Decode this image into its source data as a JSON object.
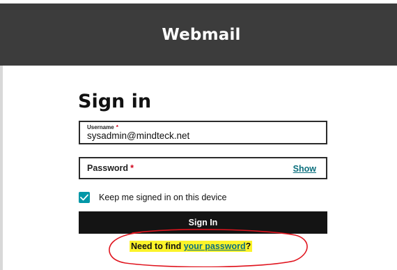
{
  "header": {
    "title": "Webmail"
  },
  "form": {
    "heading": "Sign in",
    "username": {
      "label": "Username",
      "required_marker": "*",
      "value": "sysadmin@mindteck.net"
    },
    "password": {
      "label": "Password",
      "required_marker": "*",
      "show_label": "Show"
    },
    "keep_signed_in": {
      "label": "Keep me signed in on this device",
      "checked": true
    },
    "submit_label": "Sign In",
    "help": {
      "prefix": "Need to find ",
      "link": "your password",
      "suffix": "?"
    }
  },
  "colors": {
    "header_bg": "#3c3c3c",
    "accent": "#0097a7",
    "link": "#0b6f7d",
    "button_bg": "#141414",
    "highlight": "#fbf329",
    "annotation": "#e0141e",
    "required": "#d0021b"
  },
  "icons": {
    "checkbox": "checkmark-icon"
  }
}
